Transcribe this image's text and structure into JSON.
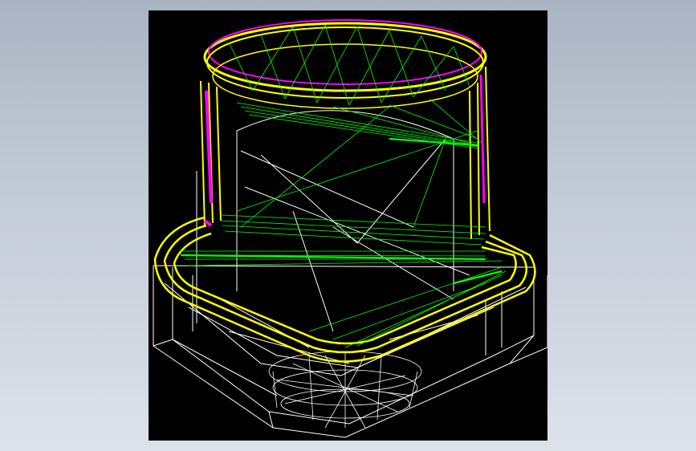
{
  "scene": {
    "background_color": "#aab4c2",
    "viewport_color": "#000000",
    "render_mode": "wireframe",
    "edge_colors": {
      "outline": "#ffffff",
      "highlight": "#ffff00",
      "accent": "#ff00ff",
      "mesh": "#00ff00"
    }
  }
}
